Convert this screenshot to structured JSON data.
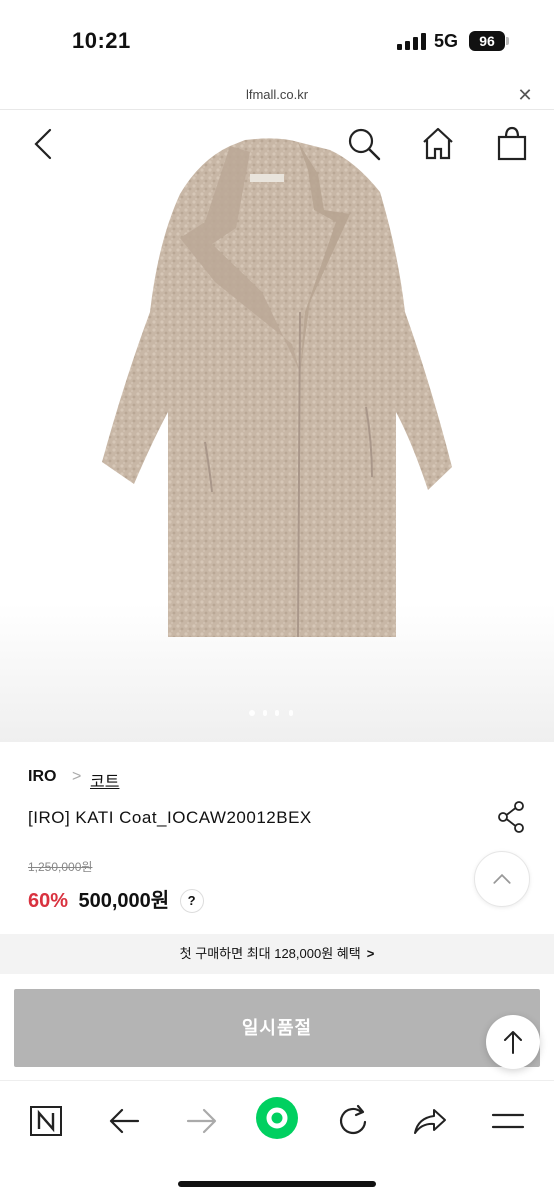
{
  "status_bar": {
    "time": "10:21",
    "network": "5G",
    "battery": "96"
  },
  "url_bar": {
    "domain": "lfmall.co.kr",
    "close_icon": "close-icon"
  },
  "header_icons": [
    "back-icon",
    "search-icon",
    "home-icon",
    "shopping-bag-icon"
  ],
  "gallery": {
    "slide_count": 4,
    "current_slide": 1
  },
  "breadcrumb": {
    "brand": "IRO",
    "separator": ">",
    "category": "코트"
  },
  "product": {
    "name": "[IRO] KATI Coat_IOCAW20012BEX",
    "original_price": "1,250,000원",
    "discount": "60%",
    "sale_price": "500,000원",
    "price_help": "?"
  },
  "promo": {
    "text": "첫 구매하면 최대 128,000원 혜택",
    "arrow": ">"
  },
  "purchase": {
    "soldout_label": "일시품절"
  },
  "toolbar_icons": [
    "naver-icon",
    "back-arrow-icon",
    "forward-arrow-icon",
    "green-dot-icon",
    "refresh-icon",
    "share-arrow-icon",
    "menu-icon"
  ],
  "colors": {
    "discount_red": "#d9323f",
    "soldout_gray": "#b4b4b4",
    "green_button": "#00d060",
    "coat_beige": "#c8b7a6",
    "promo_bg": "#f3f3f3"
  }
}
